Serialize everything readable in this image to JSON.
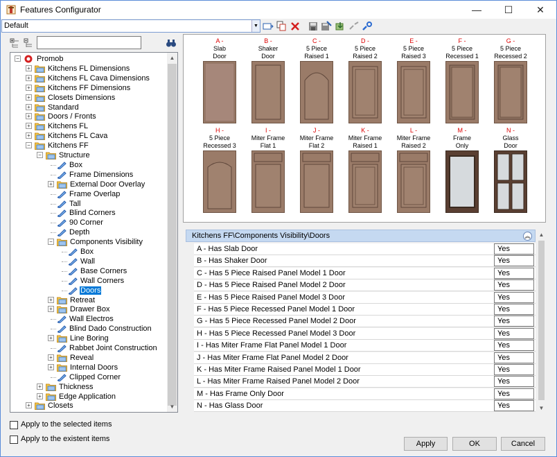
{
  "window": {
    "title": "Features Configurator",
    "minimize_glyph": "—",
    "maximize_glyph": "☐",
    "close_glyph": "✕"
  },
  "profile": {
    "value": "Default"
  },
  "toolbar_icons": [
    "apply-view-icon",
    "copy-icon",
    "delete-icon",
    "save-icon",
    "save-as-icon",
    "download-icon",
    "link-icon",
    "unlink-icon"
  ],
  "search": {
    "placeholder": ""
  },
  "tree": [
    {
      "label": "Promob",
      "level": 0,
      "exp": "-",
      "icon": "root"
    },
    {
      "label": "Kitchens FL Dimensions",
      "level": 1,
      "exp": "+",
      "icon": "folder"
    },
    {
      "label": "Kitchens FL Cava Dimensions",
      "level": 1,
      "exp": "+",
      "icon": "folder"
    },
    {
      "label": "Kitchens FF Dimensions",
      "level": 1,
      "exp": "+",
      "icon": "folder"
    },
    {
      "label": "Closets Dimensions",
      "level": 1,
      "exp": "+",
      "icon": "folder"
    },
    {
      "label": "Standard",
      "level": 1,
      "exp": "+",
      "icon": "folder"
    },
    {
      "label": "Doors / Fronts",
      "level": 1,
      "exp": "+",
      "icon": "folder"
    },
    {
      "label": "Kitchens FL",
      "level": 1,
      "exp": "+",
      "icon": "folder"
    },
    {
      "label": "Kitchens FL Cava",
      "level": 1,
      "exp": "+",
      "icon": "folder"
    },
    {
      "label": "Kitchens FF",
      "level": 1,
      "exp": "-",
      "icon": "folder"
    },
    {
      "label": "Structure",
      "level": 2,
      "exp": "-",
      "icon": "folder"
    },
    {
      "label": "Box",
      "level": 3,
      "exp": "",
      "icon": "leaf"
    },
    {
      "label": "Frame Dimensions",
      "level": 3,
      "exp": "",
      "icon": "leaf"
    },
    {
      "label": "External Door Overlay",
      "level": 3,
      "exp": "+",
      "icon": "folder"
    },
    {
      "label": "Frame Overlap",
      "level": 3,
      "exp": "",
      "icon": "leaf"
    },
    {
      "label": "Tall",
      "level": 3,
      "exp": "",
      "icon": "leaf"
    },
    {
      "label": "Blind Corners",
      "level": 3,
      "exp": "",
      "icon": "leaf"
    },
    {
      "label": "90 Corner",
      "level": 3,
      "exp": "",
      "icon": "leaf"
    },
    {
      "label": "Depth",
      "level": 3,
      "exp": "",
      "icon": "leaf"
    },
    {
      "label": "Components Visibility",
      "level": 3,
      "exp": "-",
      "icon": "folder"
    },
    {
      "label": "Box",
      "level": 4,
      "exp": "",
      "icon": "leaf"
    },
    {
      "label": "Wall",
      "level": 4,
      "exp": "",
      "icon": "leaf"
    },
    {
      "label": "Base Corners",
      "level": 4,
      "exp": "",
      "icon": "leaf"
    },
    {
      "label": "Wall Corners",
      "level": 4,
      "exp": "",
      "icon": "leaf"
    },
    {
      "label": "Doors",
      "level": 4,
      "exp": "",
      "icon": "leaf",
      "selected": true
    },
    {
      "label": "Retreat",
      "level": 3,
      "exp": "+",
      "icon": "folder"
    },
    {
      "label": "Drawer Box",
      "level": 3,
      "exp": "+",
      "icon": "folder"
    },
    {
      "label": "Wall Electros",
      "level": 3,
      "exp": "",
      "icon": "leaf"
    },
    {
      "label": "Blind Dado Construction",
      "level": 3,
      "exp": "",
      "icon": "leaf"
    },
    {
      "label": "Line Boring",
      "level": 3,
      "exp": "+",
      "icon": "folder"
    },
    {
      "label": "Rabbet Joint Construction",
      "level": 3,
      "exp": "",
      "icon": "leaf"
    },
    {
      "label": "Reveal",
      "level": 3,
      "exp": "+",
      "icon": "folder"
    },
    {
      "label": "Internal Doors",
      "level": 3,
      "exp": "+",
      "icon": "folder"
    },
    {
      "label": "Clipped Corner",
      "level": 3,
      "exp": "",
      "icon": "leaf"
    },
    {
      "label": "Thickness",
      "level": 2,
      "exp": "+",
      "icon": "folder"
    },
    {
      "label": "Edge Application",
      "level": 2,
      "exp": "+",
      "icon": "folder"
    },
    {
      "label": "Closets",
      "level": 1,
      "exp": "+",
      "icon": "folder"
    }
  ],
  "doors": [
    {
      "letter": "A -",
      "name": "Slab\nDoor",
      "style": "slab"
    },
    {
      "letter": "B -",
      "name": "Shaker\nDoor",
      "style": "shaker"
    },
    {
      "letter": "C -",
      "name": "5 Piece\nRaised 1",
      "style": "arch"
    },
    {
      "letter": "D -",
      "name": "5 Piece\nRaised 2",
      "style": "raised"
    },
    {
      "letter": "E -",
      "name": "5 Piece\nRaised 3",
      "style": "raised"
    },
    {
      "letter": "F -",
      "name": "5 Piece\nRecessed 1",
      "style": "recessed"
    },
    {
      "letter": "G -",
      "name": "5 Piece\nRecessed 2",
      "style": "recessed"
    },
    {
      "letter": "H -",
      "name": "5 Piece\nRecessed 3",
      "style": "archrec"
    },
    {
      "letter": "I -",
      "name": "Miter Frame\nFlat 1",
      "style": "miter"
    },
    {
      "letter": "J -",
      "name": "Miter Frame\nFlat 2",
      "style": "miter"
    },
    {
      "letter": "K -",
      "name": "Miter Frame\nRaised 1",
      "style": "miterr"
    },
    {
      "letter": "L -",
      "name": "Miter Frame\nRaised 2",
      "style": "miterr"
    },
    {
      "letter": "M -",
      "name": "Frame\nOnly",
      "style": "frame"
    },
    {
      "letter": "N -",
      "name": "Glass\nDoor",
      "style": "glass"
    }
  ],
  "properties": {
    "header": "Kitchens FF\\Components Visibility\\Doors",
    "rows": [
      {
        "name": "A - Has Slab Door",
        "value": "Yes"
      },
      {
        "name": "B - Has Shaker Door",
        "value": "Yes"
      },
      {
        "name": "C - Has 5 Piece Raised Panel Model 1 Door",
        "value": "Yes"
      },
      {
        "name": "D - Has 5 Piece Raised Panel Model 2 Door",
        "value": "Yes"
      },
      {
        "name": "E - Has 5 Piece Raised Panel Model 3 Door",
        "value": "Yes"
      },
      {
        "name": "F - Has 5 Piece Recessed Panel Model 1 Door",
        "value": "Yes"
      },
      {
        "name": "G - Has 5 Piece Recessed Panel Model 2 Door",
        "value": "Yes"
      },
      {
        "name": "H - Has 5 Piece Recessed Panel Model 3 Door",
        "value": "Yes"
      },
      {
        "name": "I - Has Miter Frame Flat Panel Model 1 Door",
        "value": "Yes"
      },
      {
        "name": "J - Has Miter Frame Flat Panel Model 2 Door",
        "value": "Yes"
      },
      {
        "name": "K - Has Miter Frame Raised Panel Model 1 Door",
        "value": "Yes"
      },
      {
        "name": "L - Has Miter Frame Raised Panel Model 2 Door",
        "value": "Yes"
      },
      {
        "name": "M - Has Frame Only Door",
        "value": "Yes"
      },
      {
        "name": "N - Has Glass Door",
        "value": "Yes"
      }
    ]
  },
  "options": {
    "apply_selected": "Apply to the selected items",
    "apply_existent": "Apply to the existent items"
  },
  "buttons": {
    "apply": "Apply",
    "ok": "OK",
    "cancel": "Cancel"
  },
  "colors": {
    "accent": "#0078d7",
    "wood": "#9a7b68",
    "header_bg": "#c5d9f1"
  }
}
